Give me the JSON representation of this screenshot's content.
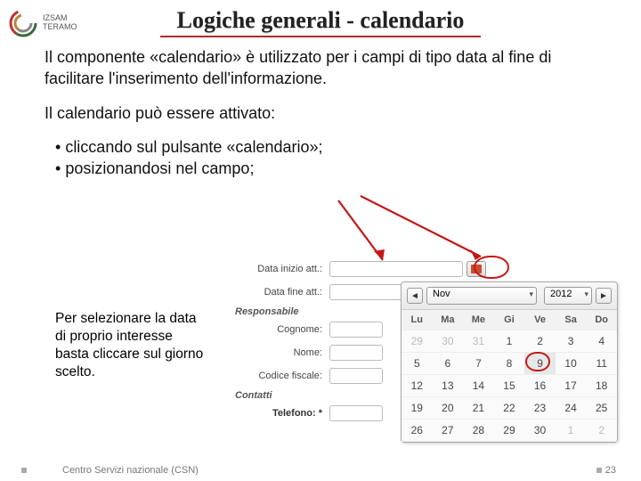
{
  "logo": {
    "line1": "IZSAM",
    "line2": "TERAMO"
  },
  "title": "Logiche generali - calendario",
  "para1": "Il componente «calendario» è utilizzato per i campi di tipo data al fine di facilitare l'inserimento dell'informazione.",
  "para2_intro": "Il calendario può essere attivato:",
  "bullet1": "cliccando sul pulsante «calendario»;",
  "bullet2": "posizionandosi nel campo;",
  "note": "Per selezionare la data di proprio interesse basta cliccare sul giorno scelto.",
  "form": {
    "label_inizio": "Data inizio att.:",
    "label_fine": "Data fine att.:",
    "section_resp": "Responsabile",
    "label_cognome": "Cognome:",
    "label_nome": "Nome:",
    "label_cf": "Codice fiscale:",
    "section_contatti": "Contatti",
    "label_tel": "Telefono: *"
  },
  "calendar": {
    "month": "Nov",
    "year": "2012",
    "dow": [
      "Lu",
      "Ma",
      "Me",
      "Gi",
      "Ve",
      "Sa",
      "Do"
    ],
    "rows": [
      [
        "29",
        "30",
        "31",
        "1",
        "2",
        "3",
        "4"
      ],
      [
        "5",
        "6",
        "7",
        "8",
        "9",
        "10",
        "11"
      ],
      [
        "12",
        "13",
        "14",
        "15",
        "16",
        "17",
        "18"
      ],
      [
        "19",
        "20",
        "21",
        "22",
        "23",
        "24",
        "25"
      ],
      [
        "26",
        "27",
        "28",
        "29",
        "30",
        "1",
        "2"
      ]
    ]
  },
  "footer": {
    "center": "Centro Servizi nazionale (CSN)",
    "page": "23"
  }
}
